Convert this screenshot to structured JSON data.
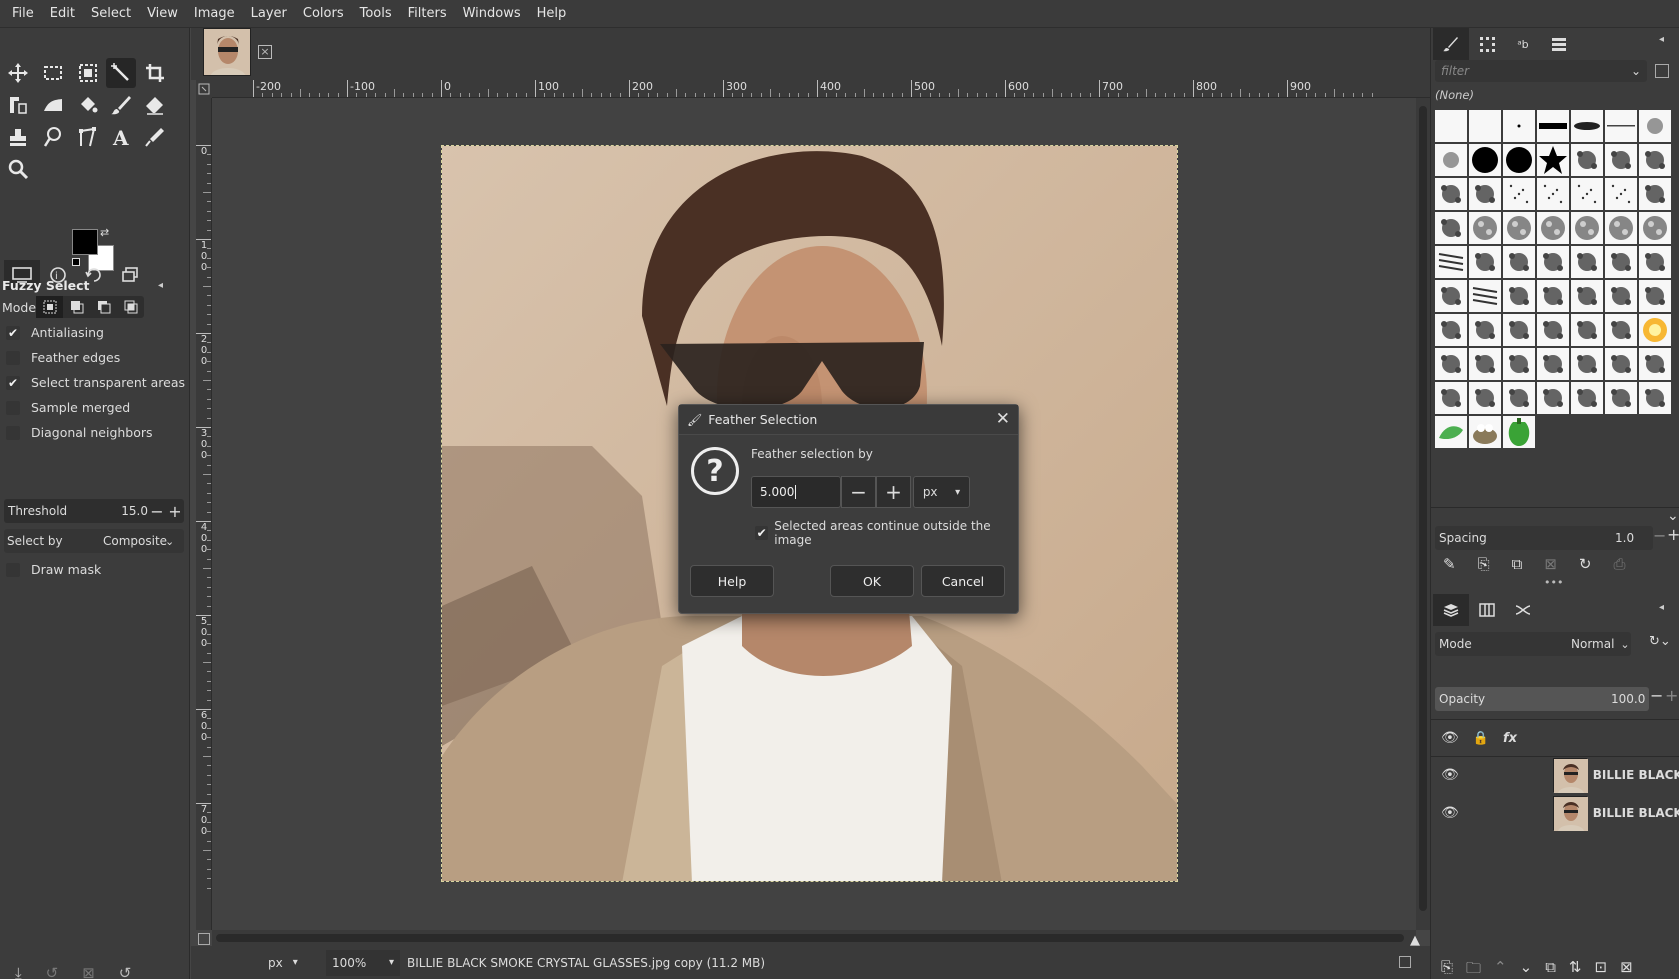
{
  "menu": [
    "File",
    "Edit",
    "Select",
    "View",
    "Image",
    "Layer",
    "Colors",
    "Tools",
    "Filters",
    "Windows",
    "Help"
  ],
  "tool_options": {
    "title": "Fuzzy Select",
    "mode_label": "Mode:",
    "antialiasing": "Antialiasing",
    "feather_edges": "Feather edges",
    "select_transparent": "Select transparent areas",
    "sample_merged": "Sample merged",
    "diagonal_neighbors": "Diagonal neighbors",
    "threshold_label": "Threshold",
    "threshold_value": "15.0",
    "select_by_label": "Select by",
    "select_by_value": "Composite",
    "draw_mask": "Draw mask"
  },
  "ruler_h": [
    "-200",
    "-100",
    "0",
    "100",
    "200",
    "300",
    "400",
    "500",
    "600",
    "700",
    "800",
    "900"
  ],
  "ruler_v": [
    "0",
    "1\n0\n0",
    "2\n0\n0",
    "3\n0\n0",
    "4\n0\n0",
    "5\n0\n0",
    "6\n0\n0",
    "7\n0\n0"
  ],
  "status": {
    "unit": "px",
    "zoom": "100%",
    "file": "BILLIE BLACK SMOKE CRYSTAL GLASSES.jpg copy (11.2 MB)"
  },
  "dialog": {
    "title": "Feather Selection",
    "prompt": "Feather selection by",
    "value": "5.000",
    "unit": "px",
    "checkbox_label": "Selected areas continue outside the image",
    "help": "Help",
    "ok": "OK",
    "cancel": "Cancel"
  },
  "brushes": {
    "filter_placeholder": "filter",
    "selected": "(None)",
    "spacing_label": "Spacing",
    "spacing_value": "1.0"
  },
  "layers": {
    "mode_label": "Mode",
    "mode_value": "Normal",
    "opacity_label": "Opacity",
    "opacity_value": "100.0",
    "items": [
      {
        "name": "BILLIE BLACK SMO"
      },
      {
        "name": "BILLIE BLACK SMO"
      }
    ]
  }
}
